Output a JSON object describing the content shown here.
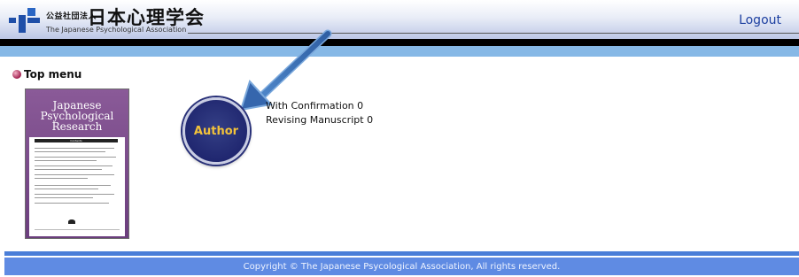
{
  "header": {
    "org_type": "公益社団法人",
    "title_jp": "日本心理学会",
    "title_en": "The Japanese Psychological Association",
    "logout_label": "Logout",
    "accent": "#1c3fa0"
  },
  "section": {
    "title": "Top menu"
  },
  "journal_cover": {
    "title": "Japanese Psychological Research",
    "contents_label": "Contents"
  },
  "main": {
    "author_button_label": "Author",
    "status_items": [
      {
        "label": "With Confirmation",
        "count": "0"
      },
      {
        "label": "Revising Manuscript",
        "count": "0"
      }
    ],
    "button_color": "#202770",
    "button_text_color": "#f2c23a"
  },
  "footer": {
    "copyright": "Copyright © The Japanese Psycological Association, All rights reserved."
  }
}
